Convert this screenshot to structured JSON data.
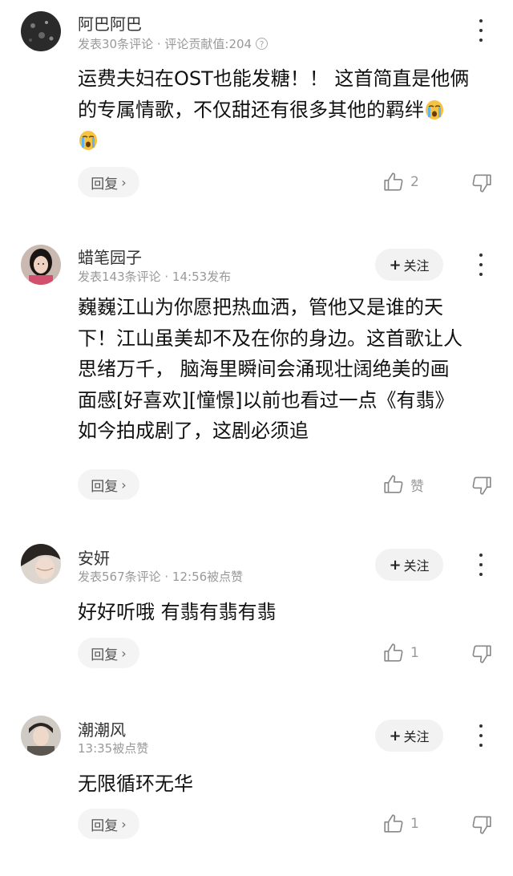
{
  "comments": [
    {
      "name": "阿巴阿巴",
      "meta_prefix": "发表30条评论 · 评论贡献值:204",
      "has_info_icon": true,
      "has_follow": false,
      "text_lines": [
        "运费夫妇在OST也能发糖！！ 这首简直是他俩",
        "的专属情歌，不仅甜还有很多其他的羁绊"
      ],
      "reply_label": "回复",
      "like_count": "2"
    },
    {
      "name": "蜡笔园子",
      "meta_prefix": "发表143条评论 · 14:53发布",
      "has_info_icon": false,
      "has_follow": true,
      "text_lines": [
        "巍巍江山为你愿把热血洒，管他又是谁的天",
        "下！江山虽美却不及在你的身边。这首歌让人",
        "思绪万千， 脑海里瞬间会涌现壮阔绝美的画",
        "面感[好喜欢][憧憬]以前也看过一点《有翡》",
        "如今拍成剧了，这剧必须追"
      ],
      "reply_label": "回复",
      "like_count": "赞"
    },
    {
      "name": "安妍",
      "meta_prefix": "发表567条评论 · 12:56被点赞",
      "has_info_icon": false,
      "has_follow": true,
      "text_lines": [
        "好好听哦 有翡有翡有翡"
      ],
      "reply_label": "回复",
      "like_count": "1"
    },
    {
      "name": "潮潮风",
      "meta_prefix": "13:35被点赞",
      "has_info_icon": false,
      "has_follow": true,
      "text_lines": [
        "无限循环无华"
      ],
      "reply_label": "回复",
      "like_count": "1"
    }
  ],
  "follow_label": "关注",
  "info_icon_symbol": "?",
  "icons": {
    "like": "thumbs-up-icon",
    "dislike": "thumbs-down-icon",
    "more": "more-vertical-icon",
    "emoji": "crying-face-emoji-icon"
  },
  "colors": {
    "name": "#333333",
    "meta": "#999999",
    "text": "#111111",
    "button_bg": "#f2f2f2"
  }
}
